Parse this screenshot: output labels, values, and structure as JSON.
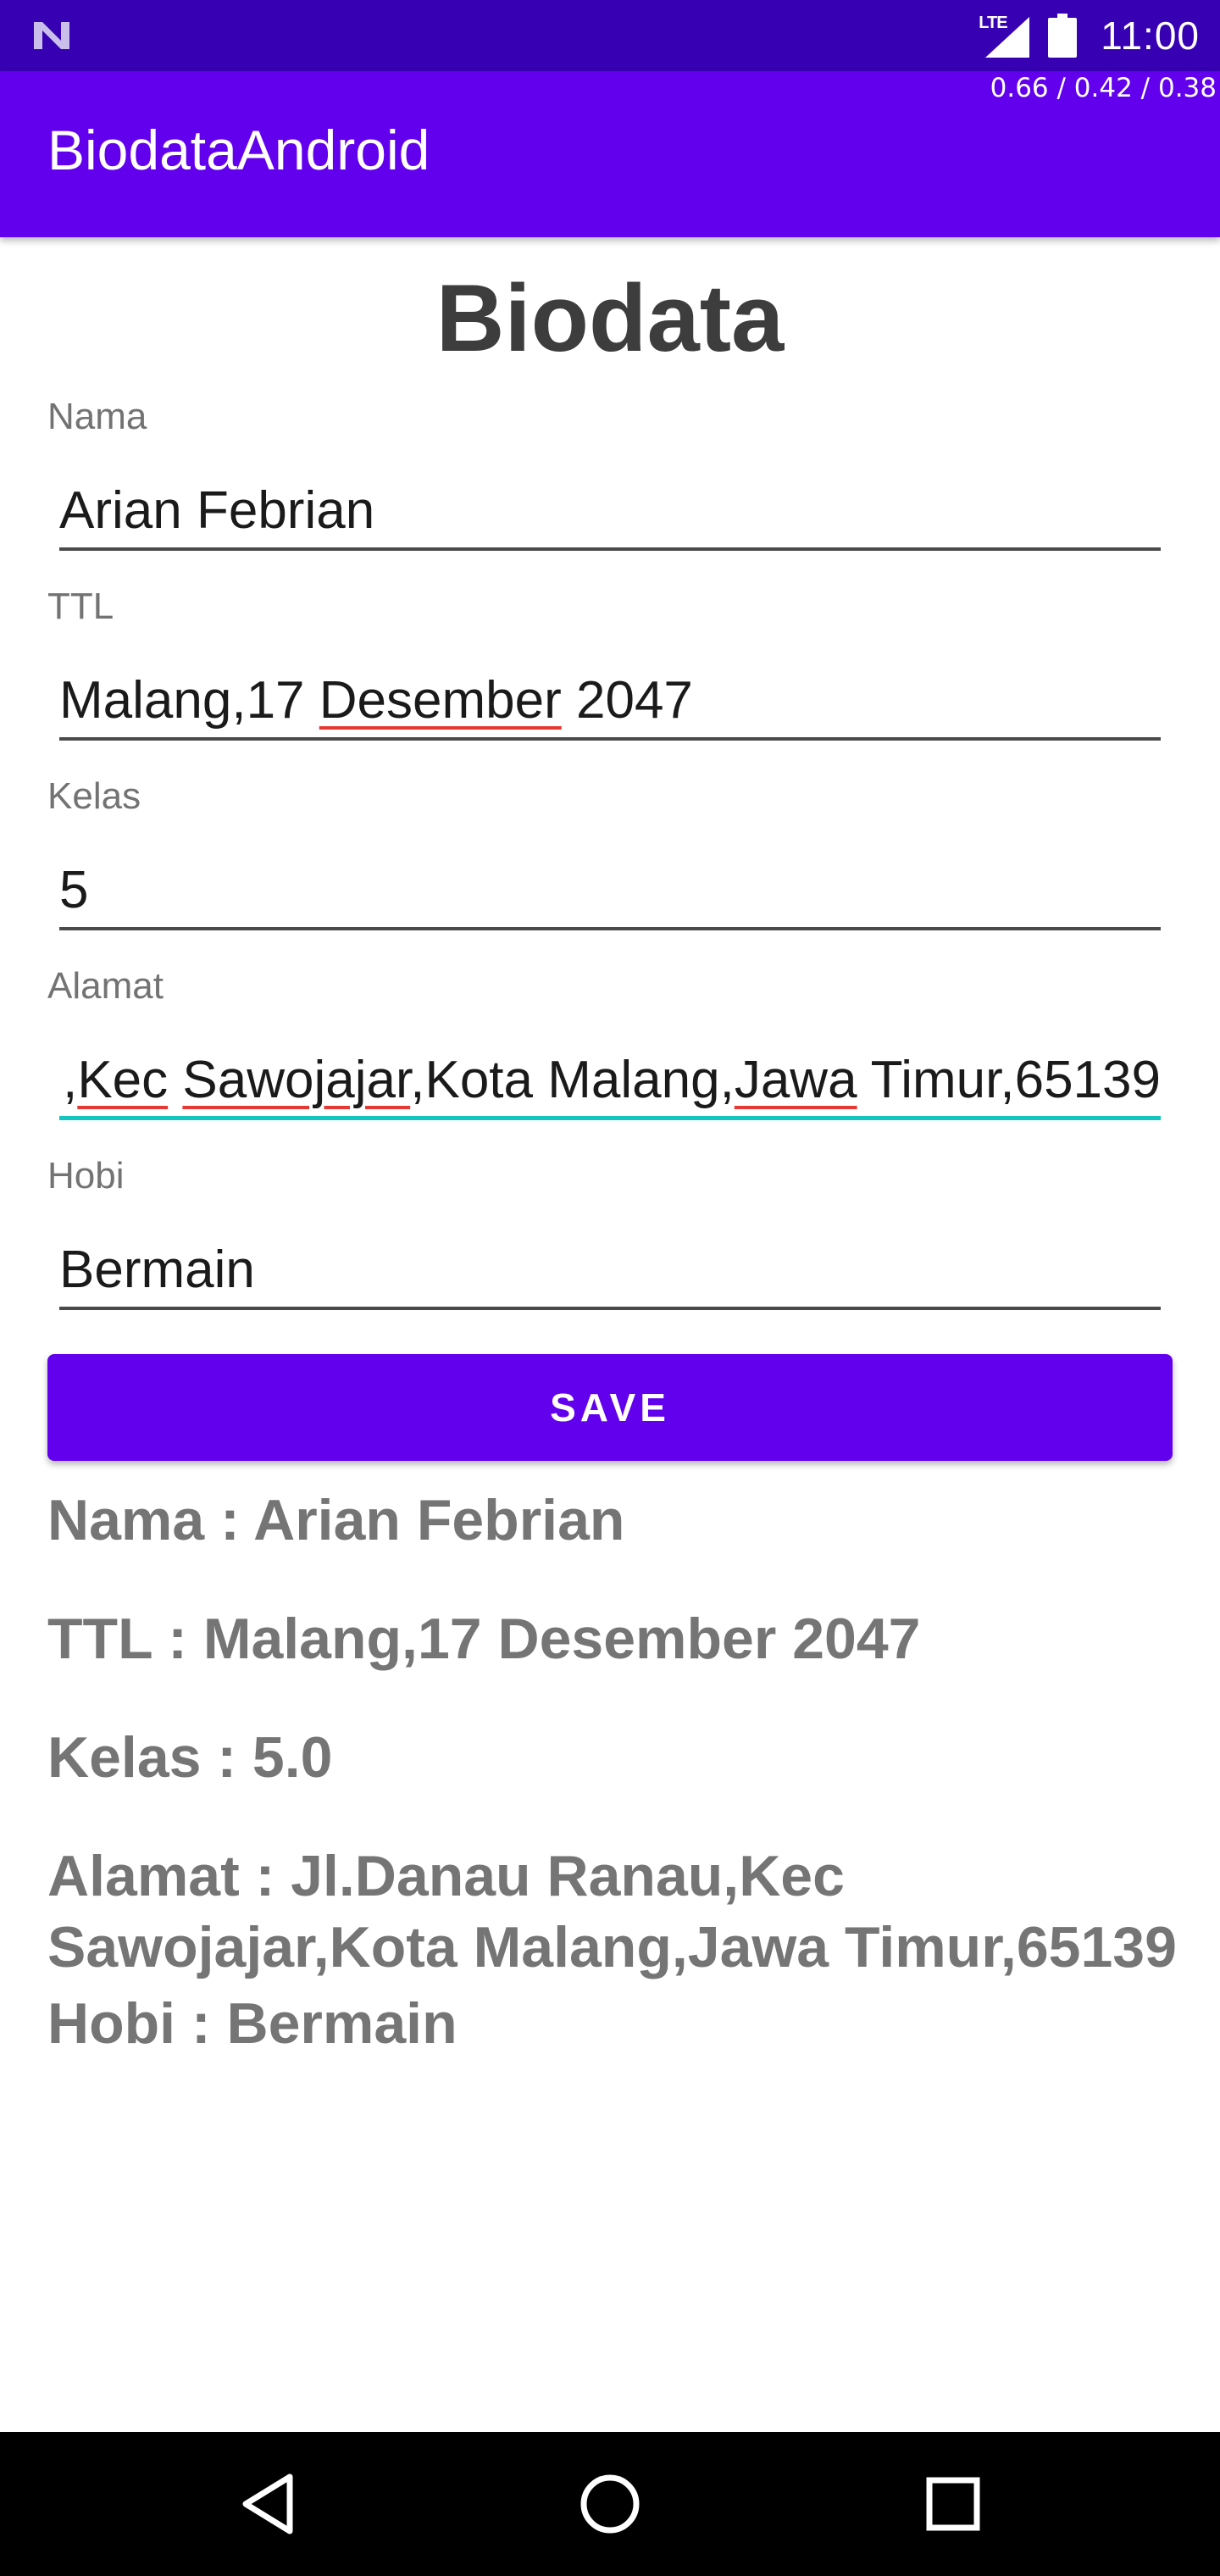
{
  "status_bar": {
    "network_label": "LTE",
    "time": "11:00",
    "icons": [
      "notification-n-icon",
      "signal-icon",
      "battery-icon"
    ]
  },
  "perf_overlay": "0.66 / 0.42 / 0.38",
  "app_bar": {
    "title": "BiodataAndroid"
  },
  "form": {
    "title": "Biodata",
    "fields": [
      {
        "label": "Nama",
        "value": "Arian Febrian"
      },
      {
        "label": "TTL",
        "value_pre": "Malang,17 ",
        "value_spell": "Desember",
        "value_post": " 2047"
      },
      {
        "label": "Kelas",
        "value": "5"
      },
      {
        "label": "Alamat",
        "value_parts": [
          ",",
          "Kec",
          " ",
          "Sawojajar",
          ",Kota Malang,",
          "Jawa",
          " Timur,65139"
        ]
      },
      {
        "label": "Hobi",
        "value": "Bermain"
      }
    ],
    "save_label": "SAVE"
  },
  "result": {
    "nama": "Nama : Arian Febrian",
    "ttl": "TTL : Malang,17 Desember 2047",
    "kelas": "Kelas : 5.0",
    "alamat": "Alamat : Jl.Danau Ranau,Kec Sawojajar,Kota Malang,Jawa Timur,65139",
    "hobi": "Hobi : Bermain"
  },
  "colors": {
    "status_bar": "#3700B3",
    "primary": "#6200EE",
    "focus_underline": "#16C5C0",
    "result_text": "#757575"
  },
  "nav_bar": {
    "icons": [
      "back-icon",
      "home-icon",
      "recents-icon"
    ]
  }
}
